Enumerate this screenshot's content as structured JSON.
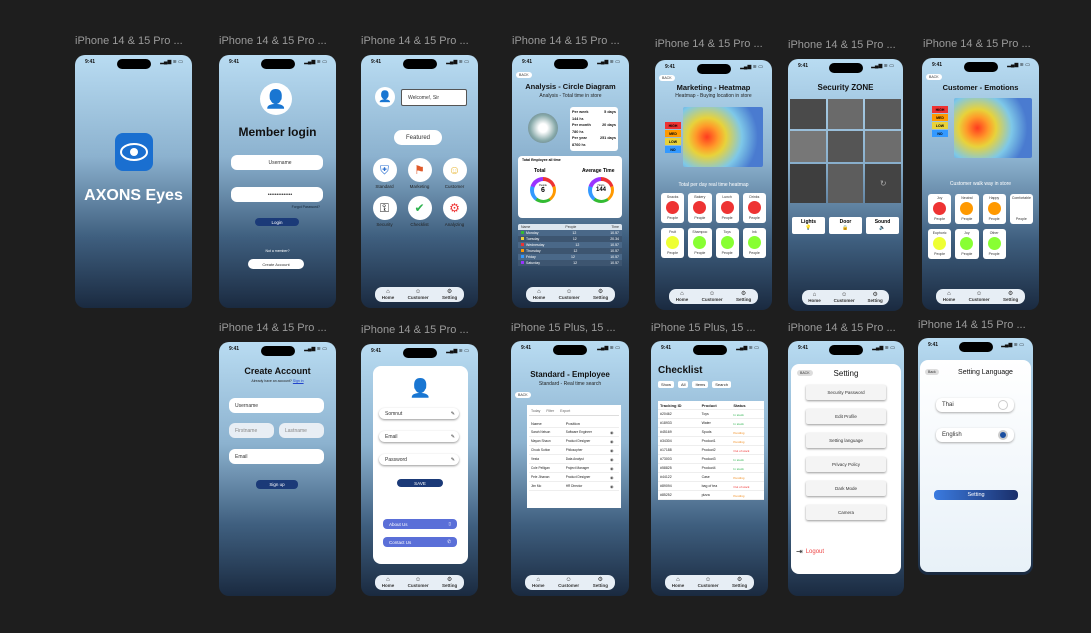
{
  "labels": {
    "s1": "iPhone 14 & 15 Pro ...",
    "s2": "iPhone 14 & 15 Pro ...",
    "s3": "iPhone 14 & 15 Pro ...",
    "s4": "iPhone 14 & 15 Pro ...",
    "s5": "iPhone 14 & 15 Pro ...",
    "s6": "iPhone 14 & 15 Pro ...",
    "s7": "iPhone 14 & 15 Pro ...",
    "s8": "iPhone 14 & 15 Pro ...",
    "s9": "iPhone 14 & 15 Pro ...",
    "s10": "iPhone 15 Plus, 15 ...",
    "s11": "iPhone 15 Plus, 15 ...",
    "s12": "iPhone 14 & 15 Pro ...",
    "s13": "iPhone 14 & 15 Pro ..."
  },
  "status": {
    "time": "9:41",
    "signal": "▂▄▆ ≋ ▭"
  },
  "nav": {
    "home": "Home",
    "customer": "Customer",
    "setting": "Setting"
  },
  "splash": {
    "app_name": "AXONS Eyes"
  },
  "login": {
    "title": "Member login",
    "username": "Username",
    "password": "••••••••••••••",
    "forgot": "Forgot Password?",
    "login_btn": "Login",
    "member_q": "Not a member?",
    "create_btn": "Create Account"
  },
  "home": {
    "welcome": "Welcome!, Sir",
    "featured": "Featured",
    "items": [
      "Standard",
      "Marketing",
      "Customer",
      "Security",
      "Checklist",
      "Analyzing"
    ]
  },
  "analysis": {
    "back": "BACK",
    "title": "Analysis - Circle Diagram",
    "subtitle": "Analysis - Total time in store",
    "stats": [
      [
        "Per week",
        "5 days"
      ],
      [
        "144 hr.",
        ""
      ],
      [
        "Per month",
        "20 days"
      ],
      [
        "780 hr.",
        ""
      ],
      [
        "Per year",
        "251 days"
      ],
      [
        "8760 hr.",
        ""
      ]
    ],
    "total_label": "Total Employee  all time",
    "total": "Total",
    "total_sub": "People",
    "total_val": "6",
    "avg": "Average Time",
    "avg_sub": "Hours",
    "avg_val": "144",
    "cols": [
      "Name",
      "People",
      "Time"
    ],
    "rows": [
      [
        "Monday",
        "12",
        "10.57"
      ],
      [
        "Tuesday",
        "12",
        "20.34"
      ],
      [
        "Wednesday",
        "12",
        "10.57"
      ],
      [
        "Thursday",
        "12",
        "10.57"
      ],
      [
        "Friday",
        "12",
        "10.57"
      ],
      [
        "Saturday",
        "12",
        "10.57"
      ]
    ]
  },
  "heatmap": {
    "back": "BACK",
    "title": "Marketing - Heatmap",
    "subtitle": "Heatmap - Buying location in store",
    "legend": [
      "HIGH",
      "MED",
      "LOW",
      "NO"
    ],
    "caption": "Total per day real time heatmap",
    "cards": [
      "Snacks",
      "Bakery",
      "Lunch",
      "Drinks",
      "Fruit",
      "Shampoo",
      "Toys",
      "Ink"
    ],
    "card_sub": "People"
  },
  "security": {
    "title": "Security ZONE",
    "lights": "Lights",
    "door": "Door",
    "sound": "Sound"
  },
  "emotion": {
    "back": "BACK",
    "title": "Customer - Emotions",
    "legend": [
      "HIGH",
      "MED",
      "LOW",
      "NO"
    ],
    "caption": "Customer walk way in store",
    "cards": [
      "Joy",
      "Neutral",
      "Happy",
      "Comfortable",
      "Euphoric",
      "Joy",
      "Other"
    ],
    "card_sub": "People"
  },
  "create": {
    "title": "Create Account",
    "already": "Already have an account?",
    "signin": "Sign in",
    "username": "Username",
    "firstname": "Firstname",
    "lastname": "Lastname",
    "email": "Email",
    "signup": "Sign up"
  },
  "profile": {
    "name": "Somnut",
    "email": "Email",
    "password": "Password",
    "save": "SAVE",
    "about": "About Us",
    "contact": "Contact Us"
  },
  "standard": {
    "title": "Standard - Employee",
    "subtitle": "Standard - Real time search",
    "back": "BACK",
    "tools": [
      "Today",
      "Filter",
      "Export"
    ],
    "cols": [
      "Name",
      "Position"
    ],
    "rows": [
      [
        "Sarah Nelson",
        "Software Engineer"
      ],
      [
        "Mayan Shaun",
        "Product Designer"
      ],
      [
        "Chuck Sutton",
        "Philosopher"
      ],
      [
        "Vesta",
        "Data Analyst"
      ],
      [
        "Cole Pelligan",
        "Project Manager"
      ],
      [
        "Pele Jihanan",
        "Product Designer"
      ],
      [
        "Jim Mo",
        "HR Director"
      ]
    ]
  },
  "checklist": {
    "title": "Checklist",
    "filters": [
      "Show",
      "All",
      "Items",
      "Search"
    ],
    "cols": [
      "Tracking ID",
      "Product",
      "Status"
    ],
    "rows": [
      [
        "#20462",
        "Toys",
        "In stock"
      ],
      [
        "#18933",
        "Water",
        "In stock"
      ],
      [
        "#45169",
        "Spuds",
        "Pending"
      ],
      [
        "#34304",
        "Product1",
        "Pending"
      ],
      [
        "#17188",
        "Product2",
        "Out of stock"
      ],
      [
        "#73003",
        "Product3",
        "In stock"
      ],
      [
        "#58825",
        "Product4",
        "In stock"
      ],
      [
        "#44122",
        "Case",
        "Pending"
      ],
      [
        "#89094",
        "bag of tea",
        "Out of stock"
      ],
      [
        "#85252",
        "pizza",
        "Pending"
      ]
    ]
  },
  "setting": {
    "back": "BACK",
    "title": "Setting",
    "items": [
      "Security Password",
      "Edit Profile",
      "Setting language",
      "Privacy Policy",
      "Dark Mode",
      "Camera"
    ],
    "logout": "Logout"
  },
  "language": {
    "back": "Back",
    "title": "Setting Language",
    "thai": "Thai",
    "english": "English",
    "btn": "Setting"
  }
}
